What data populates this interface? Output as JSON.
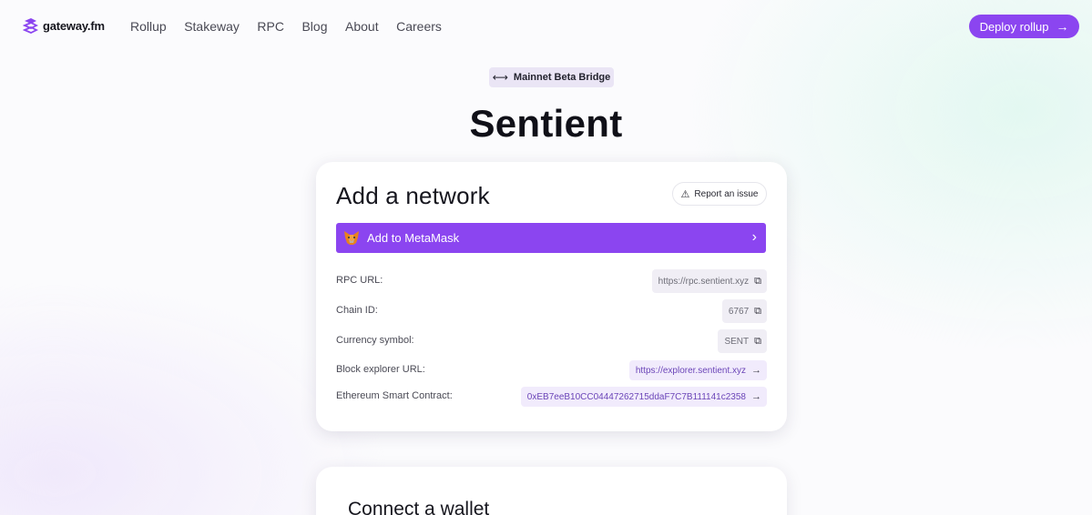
{
  "header": {
    "logo_text": "gateway.fm",
    "nav": [
      "Rollup",
      "Stakeway",
      "RPC",
      "Blog",
      "About",
      "Careers"
    ],
    "cta_label": "Deploy rollup"
  },
  "hero": {
    "badge": "Mainnet Beta Bridge",
    "title": "Sentient"
  },
  "network_card": {
    "title": "Add a network",
    "report_label": "Report an issue",
    "metamask_label": "Add to MetaMask",
    "rows": [
      {
        "label": "RPC URL:",
        "value": "https://rpc.sentient.xyz"
      },
      {
        "label": "Chain ID:",
        "value": "6767"
      },
      {
        "label": "Currency symbol:",
        "value": "SENT"
      },
      {
        "label": "Block explorer URL:",
        "value": "https://explorer.sentient.xyz"
      },
      {
        "label": "Ethereum Smart Contract:",
        "value": "0xEB7eeB10CC04447262715ddaF7C7B111141c2358"
      }
    ]
  },
  "wallet_card": {
    "title": "Connect a wallet"
  },
  "colors": {
    "accent": "#8b45f0",
    "badge_bg": "#eae5f5",
    "value_bg": "#f0eef5",
    "link_bg": "#f1ebfc"
  }
}
